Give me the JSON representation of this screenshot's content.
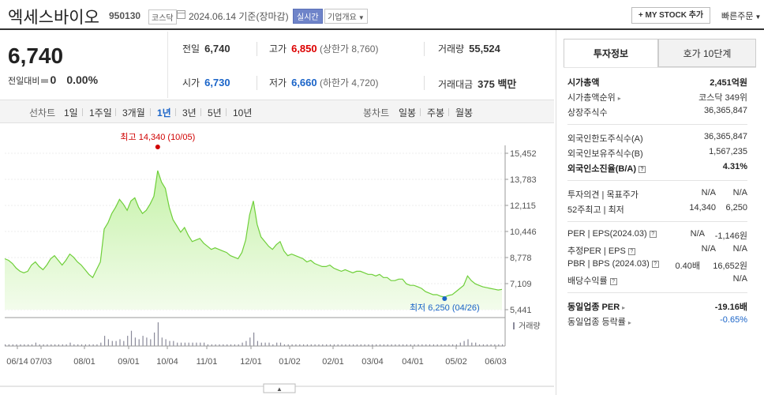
{
  "header": {
    "stock_name": "엑세스바이오",
    "stock_code": "950130",
    "market_tag": "코스닥",
    "date_text": "2024.06.14  기준(장마감)",
    "realtime_tag": "실시간",
    "overview_tag": "기업개요",
    "mystock_button": "+ MY STOCK 추가",
    "quick_order": "빠른주문"
  },
  "quote": {
    "price": "6,740",
    "change_label": "전일대비",
    "change_value": "0",
    "change_pct": "0.00%",
    "prev_label": "전일",
    "prev_value": "6,740",
    "high_label": "고가",
    "high_value": "6,850",
    "upper_limit": "(상한가 8,760)",
    "volume_label": "거래량",
    "volume_value": "55,524",
    "open_label": "시가",
    "open_value": "6,730",
    "low_label": "저가",
    "low_value": "6,660",
    "lower_limit": "(하한가 4,720)",
    "amount_label": "거래대금",
    "amount_value": "375 백만"
  },
  "periods": {
    "line_label": "선차트",
    "line_items": [
      "1일",
      "1주일",
      "3개월",
      "1년",
      "3년",
      "5년",
      "10년"
    ],
    "active": "1년",
    "candle_label": "봉차트",
    "candle_items": [
      "일봉",
      "주봉",
      "월봉"
    ]
  },
  "chart_data": {
    "type": "area",
    "y_ticks": [
      "15,452",
      "13,783",
      "12,115",
      "10,446",
      "8,778",
      "7,109",
      "5,441"
    ],
    "ylim": [
      5441,
      15452
    ],
    "x_ticks": [
      "06/14",
      "07/03",
      "08/01",
      "09/01",
      "10/04",
      "11/01",
      "12/01",
      "01/02",
      "02/01",
      "03/04",
      "04/01",
      "05/02",
      "06/03"
    ],
    "series": [
      {
        "values": [
          8700,
          8600,
          8400,
          8100,
          7900,
          7800,
          7900,
          8300,
          8500,
          8200,
          8000,
          8300,
          8700,
          8900,
          8600,
          8300,
          8600,
          9000,
          8800,
          8500,
          8300,
          8000,
          7700,
          7500,
          8000,
          8500,
          10600,
          11000,
          11600,
          12000,
          12500,
          12200,
          11800,
          12400,
          12600,
          12000,
          11600,
          11800,
          12200,
          12700,
          14340,
          13600,
          13200,
          12000,
          11200,
          10800,
          10400,
          10700,
          10200,
          9800,
          9900,
          10000,
          9700,
          9500,
          9300,
          9400,
          9300,
          9200,
          9100,
          8900,
          8800,
          8700,
          9100,
          9900,
          11500,
          12400,
          10900,
          10100,
          9800,
          9500,
          9300,
          9600,
          9800,
          9200,
          8900,
          9000,
          8900,
          8800,
          8700,
          8500,
          8600,
          8400,
          8300,
          8200,
          8200,
          8300,
          8100,
          8000,
          7900,
          8000,
          7900,
          7800,
          7900,
          7900,
          7800,
          7700,
          7700,
          7600,
          7700,
          7500,
          7500,
          7300,
          7300,
          7400,
          7400,
          7100,
          7000,
          7000,
          6900,
          6800,
          6600,
          6500,
          6400,
          6400,
          6300,
          6250,
          6350,
          6400,
          6600,
          6800,
          7000,
          7600,
          7300,
          7100,
          7000,
          6900,
          6850,
          6800,
          6750,
          6700,
          6740
        ]
      }
    ],
    "volume": [
      1,
      1,
      1,
      1,
      1,
      1,
      1,
      1,
      2,
      1,
      1,
      1,
      1,
      1,
      1,
      1,
      1,
      2,
      1,
      1,
      1,
      1,
      1,
      1,
      1,
      2,
      6,
      4,
      3,
      3,
      4,
      3,
      6,
      9,
      5,
      4,
      6,
      5,
      4,
      8,
      14,
      5,
      4,
      3,
      3,
      2,
      2,
      2,
      2,
      2,
      2,
      2,
      2,
      1,
      1,
      1,
      1,
      1,
      1,
      1,
      1,
      1,
      2,
      3,
      5,
      8,
      3,
      2,
      2,
      2,
      1,
      2,
      2,
      1,
      1,
      1,
      1,
      1,
      1,
      1,
      1,
      1,
      1,
      1,
      1,
      1,
      1,
      1,
      1,
      1,
      1,
      1,
      1,
      1,
      1,
      1,
      1,
      1,
      1,
      1,
      1,
      1,
      1,
      1,
      1,
      1,
      1,
      1,
      1,
      1,
      1,
      1,
      1,
      1,
      1,
      1,
      1,
      1,
      1,
      2,
      3,
      4,
      2,
      2,
      1,
      1,
      1,
      1,
      1,
      1,
      1
    ],
    "max_label": "최고 14,340 (10/05)",
    "min_label": "최저 6,250 (04/26)",
    "max_index": 40,
    "min_index": 115,
    "volume_label": "거래량",
    "colors": {
      "line": "#6fcf3a",
      "fill_top": "#c5f2a8",
      "fill_bottom": "#f3fcec",
      "max": "#d00000",
      "min": "#1a64c8",
      "volume": "#8a8a9a"
    }
  },
  "panel": {
    "tab_active": "투자정보",
    "tab_other": "호가 10단계",
    "market_cap_label": "시가총액",
    "market_cap_value": "2,451억원",
    "market_cap_rank_label": "시가총액순위",
    "market_cap_rank_value": "코스닥 349위",
    "shares_label": "상장주식수",
    "shares_value": "36,365,847",
    "foreign_limit_label": "외국인한도주식수(A)",
    "foreign_limit_value": "36,365,847",
    "foreign_hold_label": "외국인보유주식수(B)",
    "foreign_hold_value": "1,567,235",
    "foreign_ratio_label": "외국인소진율(B/A)",
    "foreign_ratio_value": "4.31%",
    "opinion_label": "투자의견 | 목표주가",
    "opinion_value": "N/A",
    "target_value": "N/A",
    "w52_label": "52주최고 | 최저",
    "w52_high": "14,340",
    "w52_low": "6,250",
    "per_label": "PER | EPS(2024.03)",
    "per_value": "N/A",
    "eps_value": "-1,146원",
    "est_per_label": "추정PER | EPS",
    "est_per_value": "N/A",
    "est_eps_value": "N/A",
    "pbr_label": "PBR | BPS (2024.03)",
    "pbr_value": "0.40배",
    "bps_value": "16,652원",
    "dividend_label": "배당수익률",
    "dividend_value": "N/A",
    "sector_per_label": "동일업종 PER",
    "sector_per_value": "-19.16배",
    "sector_chg_label": "동일업종 등락률",
    "sector_chg_value": "-0.65%"
  }
}
